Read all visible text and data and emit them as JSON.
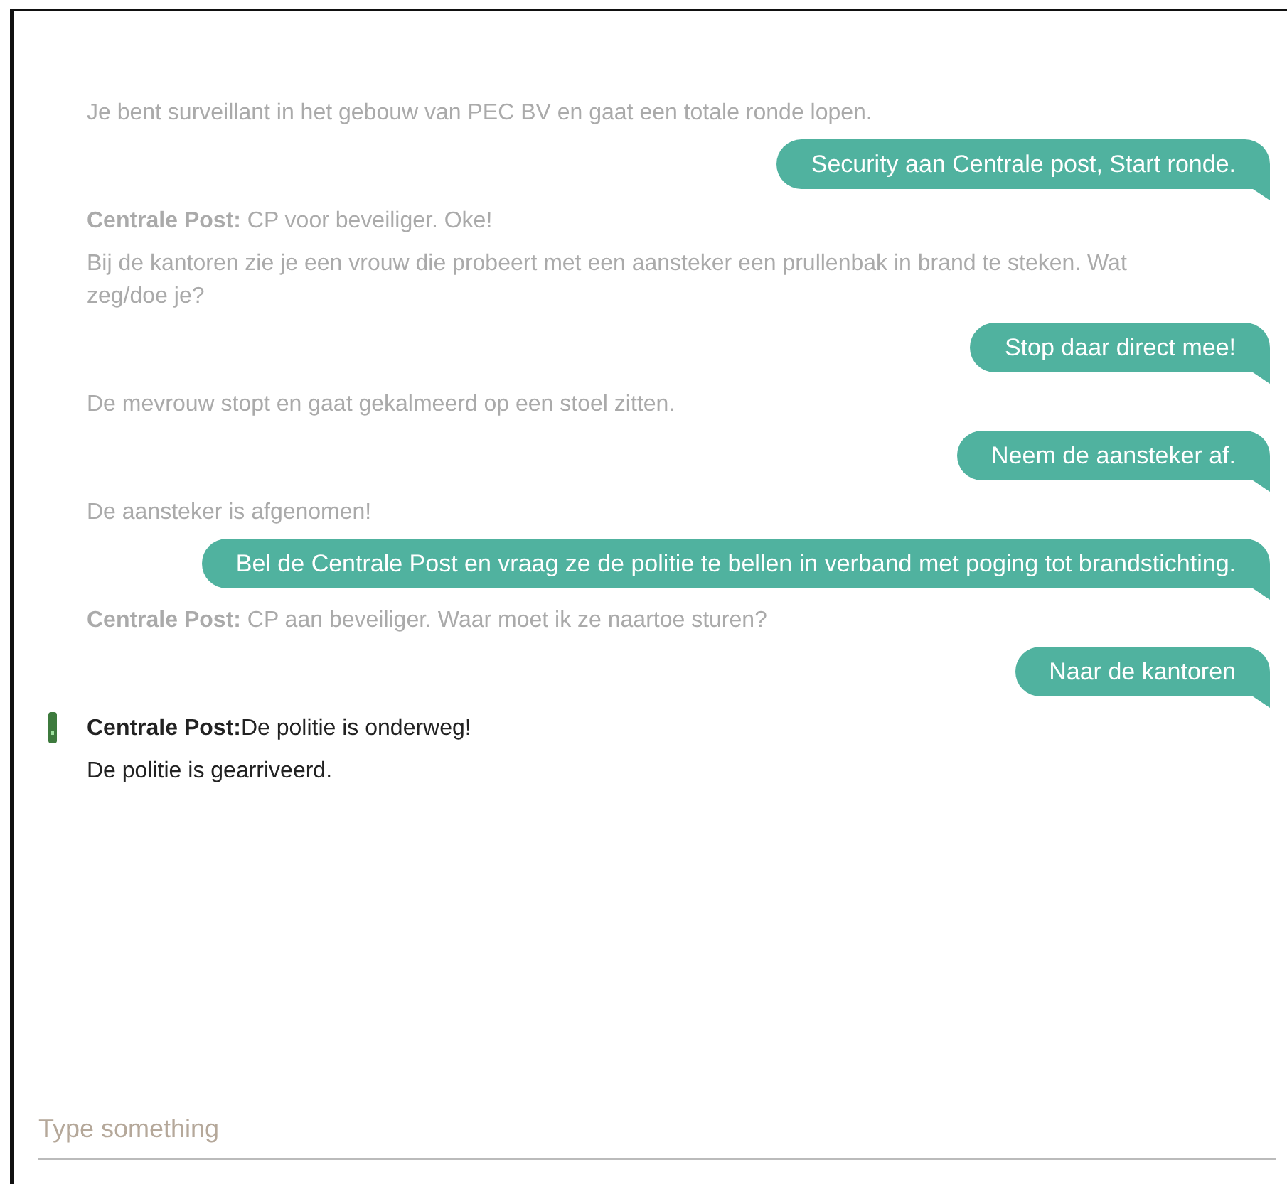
{
  "messages": [
    {
      "kind": "narration",
      "faded": true,
      "text": "Je bent surveillant in het gebouw van PEC BV en gaat een totale ronde lopen."
    },
    {
      "kind": "user",
      "text": "Security aan Centrale post, Start ronde."
    },
    {
      "kind": "narration",
      "faded": true,
      "speaker": "Centrale Post:",
      "text": " CP voor beveiliger. Oke!"
    },
    {
      "kind": "narration",
      "faded": true,
      "text": "Bij de kantoren zie je een vrouw die probeert met een aansteker een prullenbak in brand te steken. Wat zeg/doe je?"
    },
    {
      "kind": "user",
      "text": "Stop daar direct mee!"
    },
    {
      "kind": "narration",
      "faded": true,
      "text": "De mevrouw stopt en gaat gekalmeerd op een stoel zitten."
    },
    {
      "kind": "user",
      "text": "Neem de aansteker af."
    },
    {
      "kind": "narration",
      "faded": true,
      "text": "De aansteker is afgenomen!"
    },
    {
      "kind": "user",
      "text": "Bel de Centrale Post en vraag ze de politie te bellen in verband met poging tot brandstichting."
    },
    {
      "kind": "narration",
      "faded": true,
      "speaker": "Centrale Post:",
      "text": " CP aan beveiliger. Waar moet ik ze naartoe sturen?"
    },
    {
      "kind": "user",
      "text": "Naar de kantoren"
    },
    {
      "kind": "narration",
      "faded": false,
      "marker": true,
      "speaker": "Centrale Post:",
      "text": "De politie is onderweg!"
    },
    {
      "kind": "narration",
      "faded": false,
      "text": "De politie is gearriveerd."
    }
  ],
  "input": {
    "placeholder": "Type something"
  }
}
